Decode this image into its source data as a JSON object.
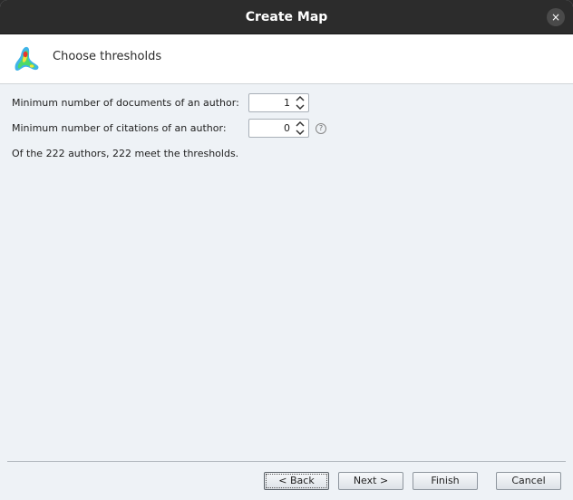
{
  "window": {
    "title": "Create Map",
    "close_glyph": "×"
  },
  "header": {
    "title": "Choose thresholds",
    "icon": "vosviewer-logo-icon"
  },
  "form": {
    "min_documents": {
      "label": "Minimum number of documents of an author:",
      "value": "1"
    },
    "min_citations": {
      "label": "Minimum number of citations of an author:",
      "value": "0"
    },
    "help_glyph": "?",
    "status": "Of the 222 authors, 222 meet the thresholds."
  },
  "buttons": {
    "back": "< Back",
    "next": "Next >",
    "finish": "Finish",
    "cancel": "Cancel"
  },
  "colors": {
    "titlebar": "#2c2c2c",
    "panel": "#eef2f6",
    "header": "#ffffff"
  }
}
